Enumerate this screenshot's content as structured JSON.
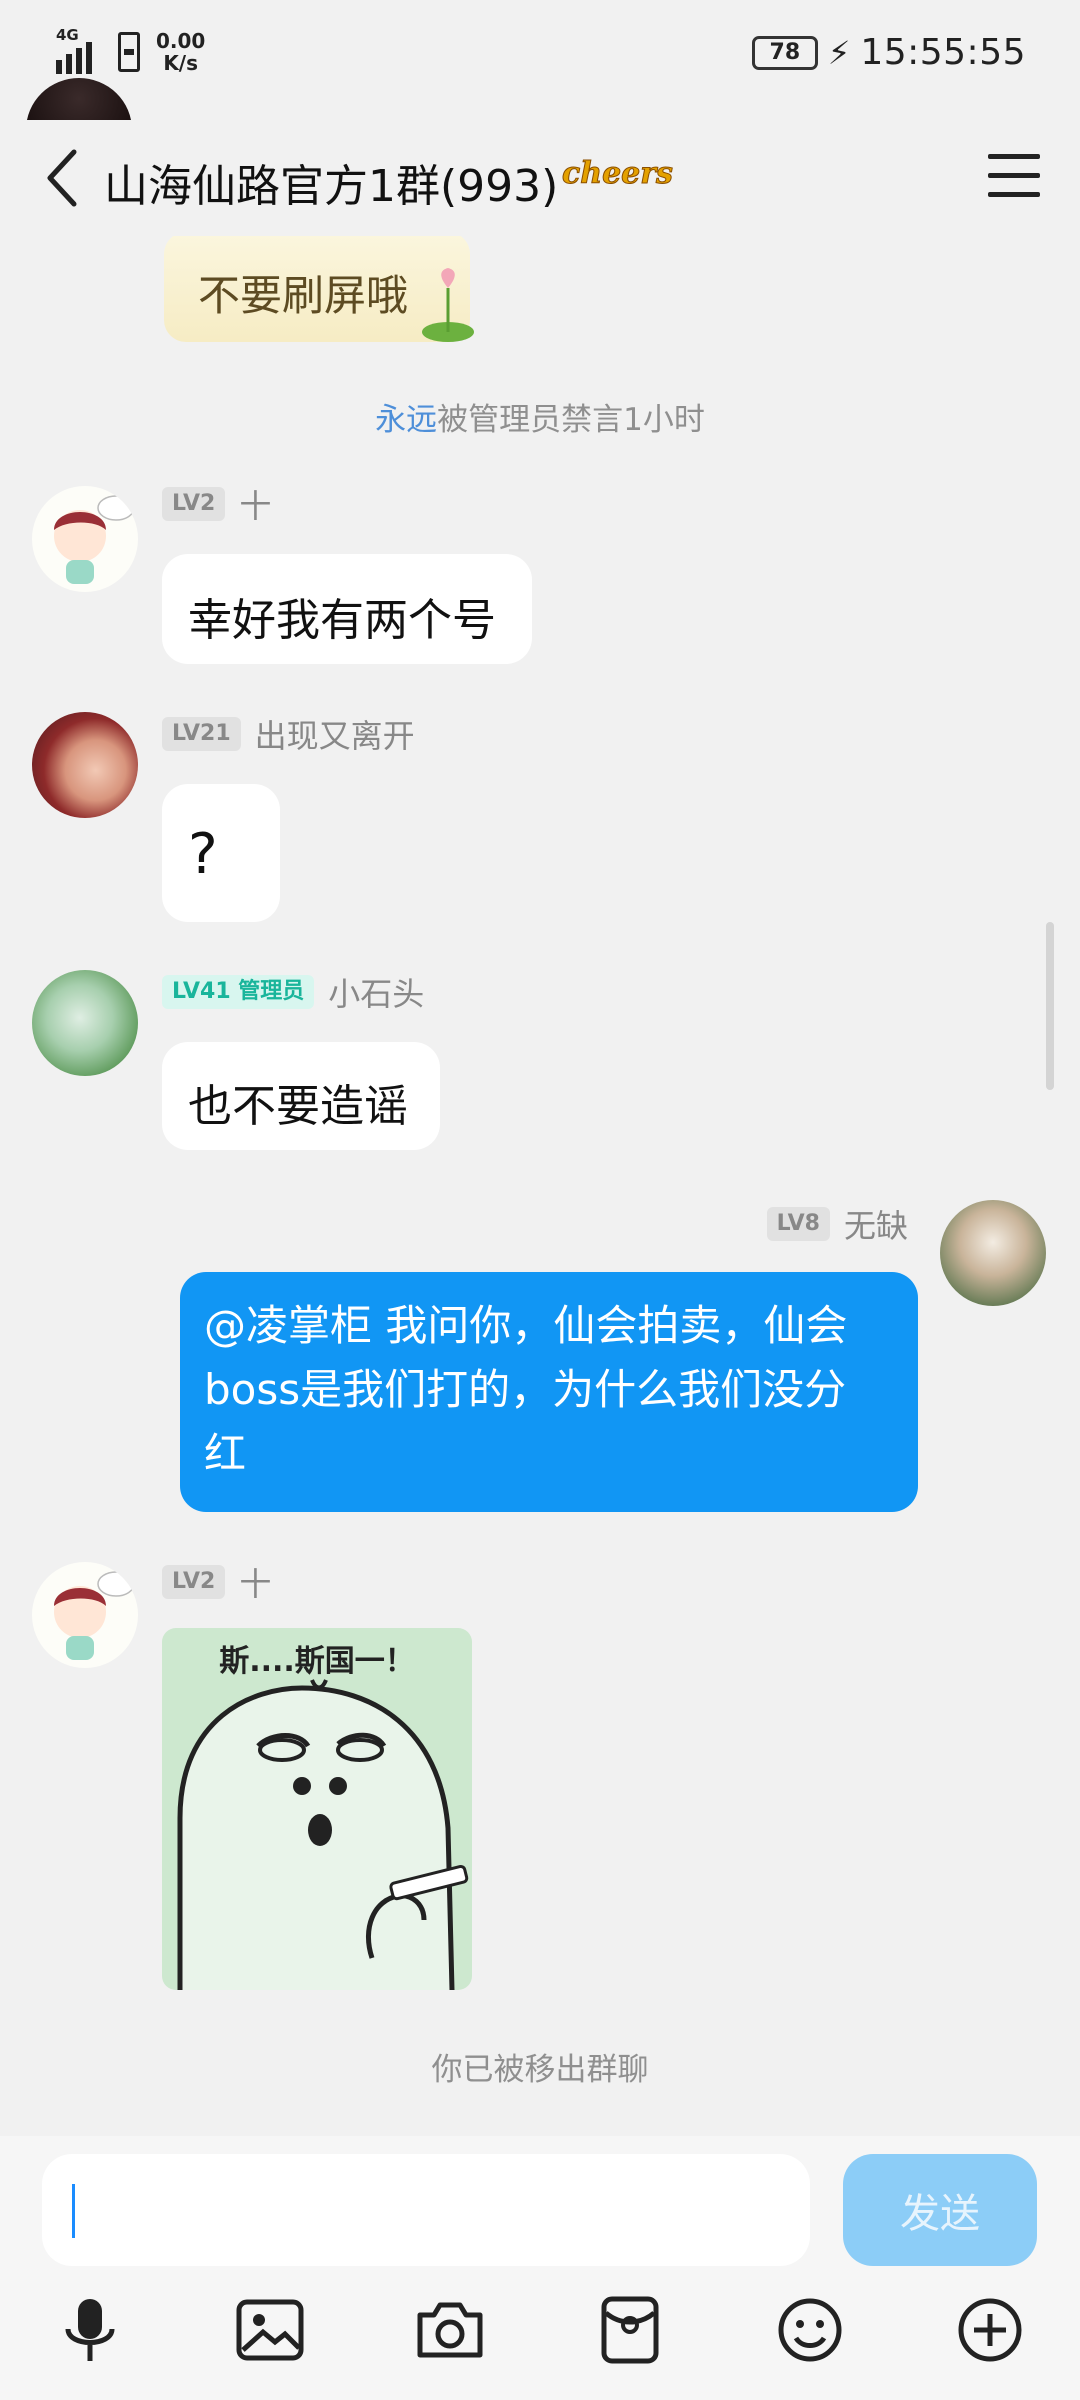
{
  "status_bar": {
    "network": "4G",
    "speed_value": "0.00",
    "speed_unit": "K/s",
    "battery": "78",
    "time": "15:55:55"
  },
  "header": {
    "title": "山海仙路官方1群(993)",
    "badge": "cheers"
  },
  "messages": {
    "m0": {
      "text": "不要刷屏哦"
    },
    "sys1": {
      "name": "永远",
      "text": "被管理员禁言1小时"
    },
    "m1": {
      "level": "LV2",
      "name": "十",
      "text": "幸好我有两个号"
    },
    "m2": {
      "level": "LV21",
      "name": "出现又离开",
      "text": "?"
    },
    "m3": {
      "level": "LV41 管理员",
      "name": "小石头",
      "text": "也不要造谣"
    },
    "m4": {
      "level": "LV8",
      "name": "无缺",
      "text": "@凌掌柜 我问你，仙会拍卖，仙会boss是我们打的，为什么我们没分红"
    },
    "m5": {
      "level": "LV2",
      "name": "十",
      "sticker_text": "斯....斯国一！"
    },
    "sys2": {
      "text": "你已被移出群聊"
    }
  },
  "input": {
    "placeholder": "",
    "send_label": "发送"
  },
  "toolbar": {
    "icons": [
      "microphone-icon",
      "image-icon",
      "camera-icon",
      "red-packet-icon",
      "emoji-icon",
      "plus-icon"
    ]
  },
  "colors": {
    "background": "#f1f1f1",
    "own_bubble": "#1196f4",
    "send_button": "#8ccdf7",
    "admin_badge": "#19b59b",
    "link": "#4e8fd9"
  }
}
